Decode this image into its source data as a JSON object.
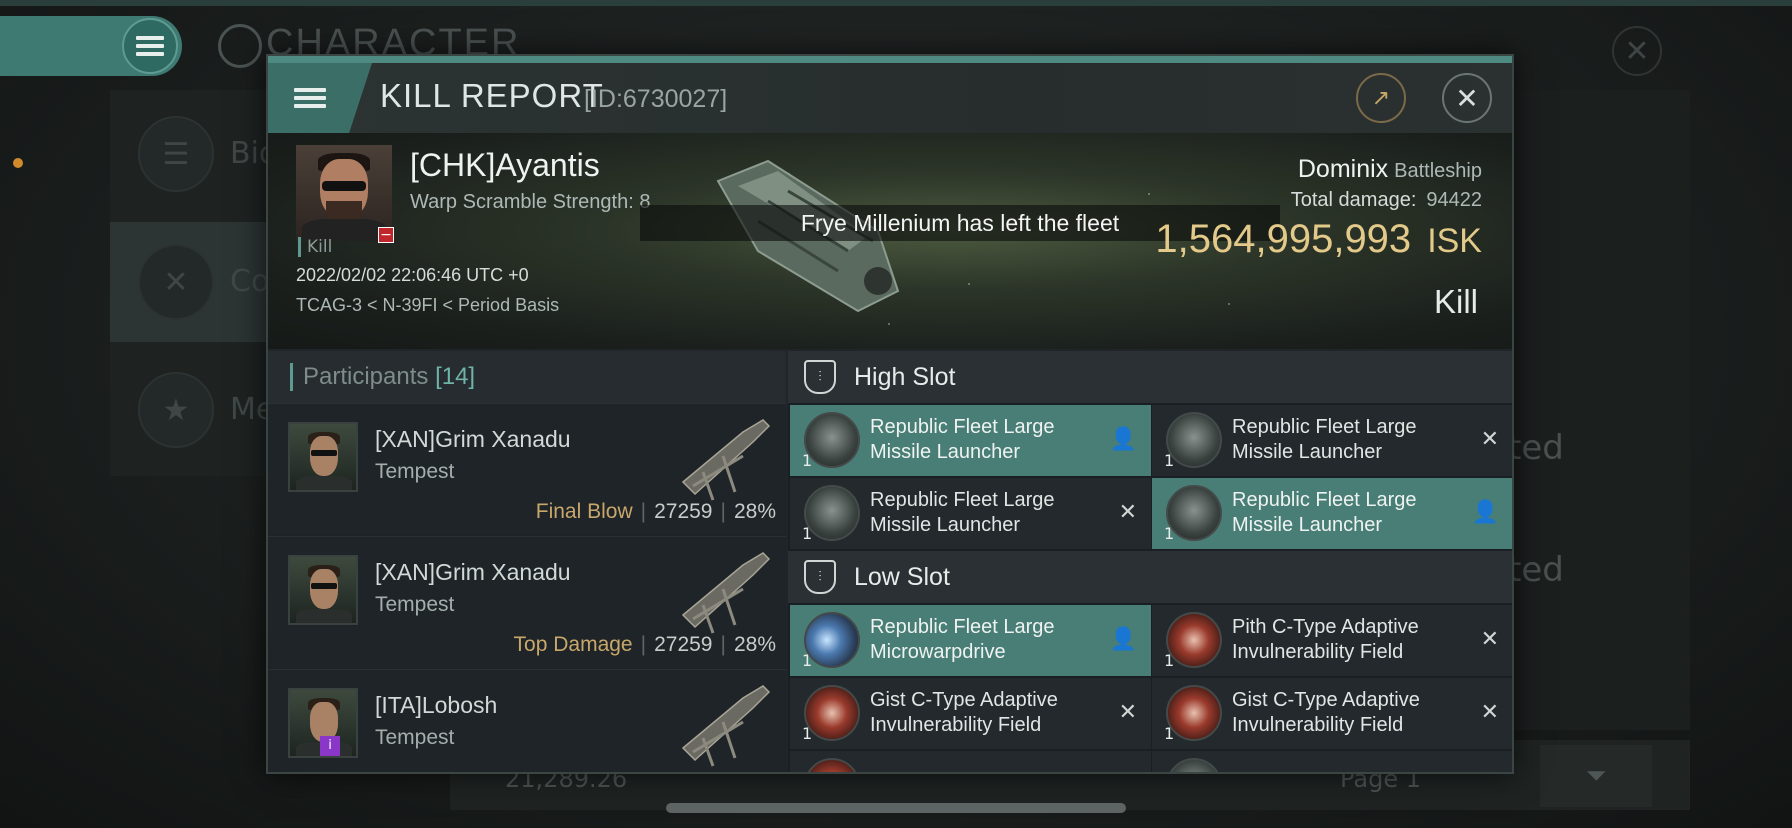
{
  "background": {
    "character_title": "CHARACTER",
    "side_items": [
      {
        "label": "Bio",
        "icon": "list-icon"
      },
      {
        "label": "Co",
        "icon": "swords-icon"
      },
      {
        "label": "Me",
        "icon": "star-icon"
      }
    ],
    "right_texts": [
      "ted",
      "ted"
    ],
    "bottom_value": "21,289.26",
    "bottom_page": "Page 1"
  },
  "header": {
    "title": "KILL REPORT",
    "id": "[ID:6730027]",
    "share_icon": "share-icon",
    "close_icon": "close-icon"
  },
  "victim": {
    "name": "[CHK]Ayantis",
    "warp_scramble": "Warp Scramble Strength: 8",
    "kill_tag": "Kill",
    "datetime": "2022/02/02 22:06:46 UTC +0",
    "location": "TCAG-3 < N-39FI < Period Basis",
    "ship": "Dominix",
    "ship_class": "Battleship",
    "total_damage_label": "Total damage:",
    "total_damage": "94422",
    "isk_value": "1,564,995,993",
    "isk_unit": "ISK",
    "result": "Kill"
  },
  "notice": "Frye Millenium has left the fleet",
  "participants": {
    "label": "Participants",
    "count": "[14]",
    "rows": [
      {
        "name": "[XAN]Grim Xanadu",
        "ship": "Tempest",
        "tag": "Final Blow",
        "damage": "27259",
        "percent": "28%"
      },
      {
        "name": "[XAN]Grim Xanadu",
        "ship": "Tempest",
        "tag": "Top Damage",
        "damage": "27259",
        "percent": "28%"
      },
      {
        "name": "[ITA]Lobosh",
        "ship": "Tempest",
        "tag": "",
        "damage": "",
        "percent": ""
      }
    ]
  },
  "slots": {
    "high": {
      "label": "High Slot",
      "modules": [
        {
          "name": "Republic Fleet Large Missile Launcher",
          "qty": "1",
          "status": "dropped"
        },
        {
          "name": "Republic Fleet Large Missile Launcher",
          "qty": "1",
          "status": "destroyed"
        },
        {
          "name": "Republic Fleet Large Missile Launcher",
          "qty": "1",
          "status": "destroyed"
        },
        {
          "name": "Republic Fleet Large Missile Launcher",
          "qty": "1",
          "status": "dropped"
        }
      ]
    },
    "low": {
      "label": "Low Slot",
      "modules": [
        {
          "name": "Republic Fleet Large Microwarpdrive",
          "qty": "1",
          "status": "dropped"
        },
        {
          "name": "Pith C-Type Adaptive Invulnerability Field",
          "qty": "1",
          "status": "destroyed"
        },
        {
          "name": "Gist C-Type Adaptive Invulnerability Field",
          "qty": "1",
          "status": "destroyed"
        },
        {
          "name": "Gist C-Type Adaptive Invulnerability Field",
          "qty": "1",
          "status": "destroyed"
        }
      ]
    }
  },
  "colors": {
    "accent": "#487e76",
    "isk_gold": "#e3c98a",
    "tag_gold": "#c8a76a"
  }
}
